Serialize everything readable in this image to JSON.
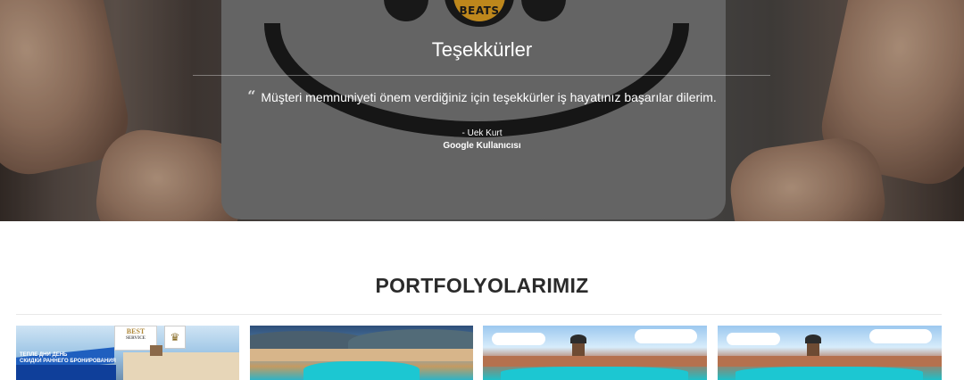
{
  "testimonial": {
    "title": "Teşekkürler",
    "quote_mark": "“",
    "quote": "Müşteri memnuniyeti önem verdiğiniz için teşekkürler iş hayatınız başarılar dilerim.",
    "author": "- Uek Kurt",
    "source": "Google Kullanıcısı",
    "logo_text": "BEATS"
  },
  "portfolio": {
    "title": "PORTFOLYOLARIMIZ",
    "items": [
      {
        "type": "flyer",
        "logo_lines": [
          "BEST",
          "SERVICE"
        ],
        "banner_lines": [
          "ТЕПЛЕ ДНИ ДЕНЬ",
          "СКИДКИ РАННЕГО БРОНИРОВАНИЯ"
        ]
      },
      {
        "type": "resort-panorama"
      },
      {
        "type": "castle-resort"
      },
      {
        "type": "castle-resort"
      }
    ]
  }
}
